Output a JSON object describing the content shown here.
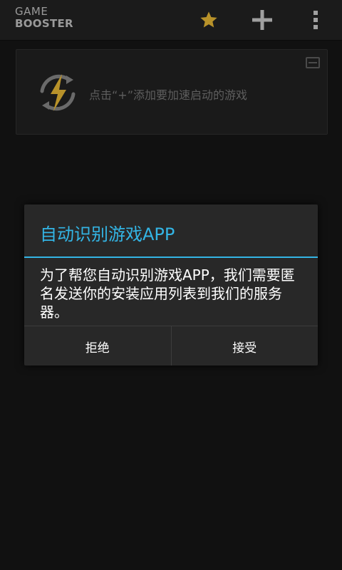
{
  "app_bar": {
    "logo_line1": "GAME",
    "logo_line2": "BOOSTER",
    "actions": [
      "star-icon",
      "add-icon",
      "overflow-menu-icon"
    ]
  },
  "card": {
    "hint": "点击“+”添加要加速启动的游戏",
    "icon": "lightning-refresh-icon"
  },
  "dialog": {
    "title": "自动识别游戏APP",
    "message": "为了帮您自动识别游戏APP，我们需要匿名发送你的安装应用列表到我们的服务器。",
    "reject_label": "拒绝",
    "accept_label": "接受"
  },
  "colors": {
    "accent": "#33b5e5",
    "star": "#b8922a",
    "background": "#111111",
    "dialog_background": "#282828"
  }
}
